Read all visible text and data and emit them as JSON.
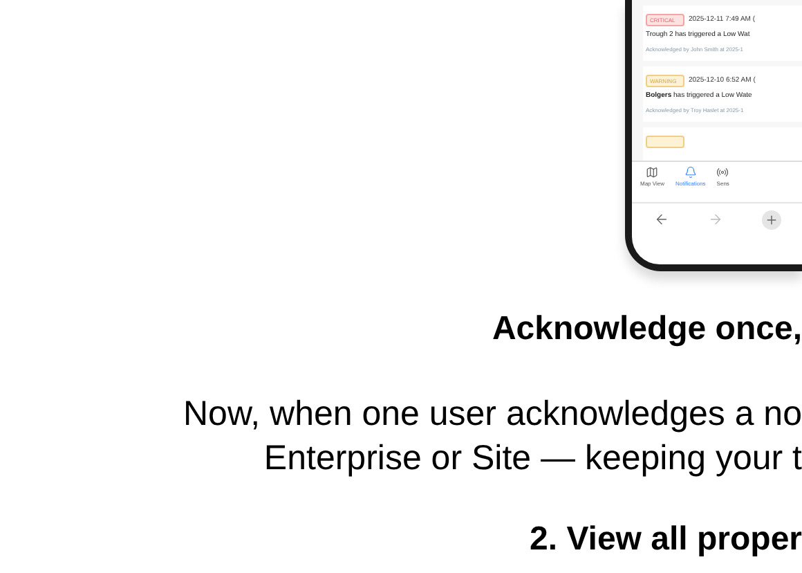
{
  "phone": {
    "notifications": [
      {
        "kind": "critical",
        "severity": "CRITICAL",
        "timestamp": "2025-12-11 7:49 AM (",
        "message": "Trough 2  has triggered a Low Wat",
        "acknowledgement": "Acknowledged by  John Smith  at 2025-1"
      },
      {
        "kind": "warning",
        "severity": "WARNING",
        "timestamp": "2025-12-10 6:52 AM (",
        "message": "**Bolgers** has triggered a Low Wate",
        "acknowledgement": "Acknowledged by Troy Haslet at 2025-1"
      },
      {
        "kind": "warning"
      }
    ],
    "nav": [
      {
        "kind": "map",
        "label": "Map View",
        "selected": false
      },
      {
        "kind": "bell",
        "label": "Notifications",
        "selected": true
      },
      {
        "kind": "sensor",
        "label": "Sens",
        "selected": false
      }
    ],
    "browser_bar": [
      {
        "kind": "back",
        "disabled": false
      },
      {
        "kind": "forward",
        "disabled": true
      },
      {
        "kind": "new-tab",
        "disabled": false
      }
    ]
  },
  "heading": "Acknowledge once,",
  "paragraph_lines": [
    "Now, when one user acknowledges a no",
    "Enterprise or Site — keeping your t"
  ],
  "next_heading": "2. View all proper"
}
